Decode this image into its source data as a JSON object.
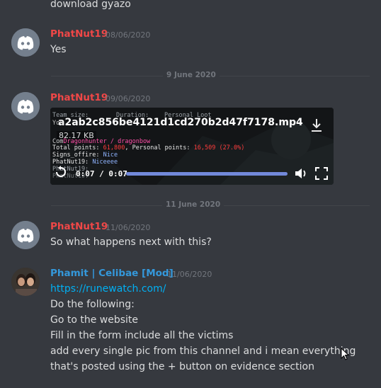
{
  "messages_top": {
    "partial_text": "download gyazo"
  },
  "msg1": {
    "author": "PhatNut19",
    "timestamp": "08/06/2020",
    "text": "Yes"
  },
  "divider1": {
    "label": "9 June 2020"
  },
  "msg2": {
    "author": "PhatNut19",
    "timestamp": "09/06/2020",
    "attachment": {
      "filename": "a2ab2c856be4121d1cd270b2d47f7178.mp4",
      "filesize": "82.17 KB",
      "time_display": "0:07 / 0:07",
      "progress": 1.0,
      "overlay": {
        "header_left": "Team size:",
        "header_mid": "Duration:",
        "header_right": "Personal Loot",
        "you_row": "You",
        "boss_row": "Dragonhunter / dragonbow",
        "points_label": "Total points:",
        "points_value": "61,800",
        "personal_label": "Personal points:",
        "personal_value": "16,509",
        "personal_pct": "(27.0%)",
        "signs_label": "Signs_offire:",
        "signs_value": "Nice",
        "chat1_name": "PhatNut19:",
        "chat1_text": "Niceeee",
        "chat2_name": "PhatNut19:",
        "chat3_name": "PhatNut19:"
      }
    }
  },
  "divider2": {
    "label": "11 June 2020"
  },
  "msg3": {
    "author": "PhatNut19",
    "timestamp": "11/06/2020",
    "text": "So what happens next with this?"
  },
  "msg4": {
    "author": "Phamit | Celibae [Mod]",
    "timestamp": "11/06/2020",
    "link": "https://runewatch.com/",
    "lines": [
      "Do the following:",
      "Go to the website",
      "Fill in the form include all the victims",
      "add every single pic from this channel and i mean everything",
      "that's posted using the + button on evidence section"
    ]
  },
  "colors": {
    "background": "#36393f",
    "author_red": "#f04747",
    "author_mod": "#3498db",
    "link": "#00b0f4",
    "progress_fill": "#7289da"
  }
}
